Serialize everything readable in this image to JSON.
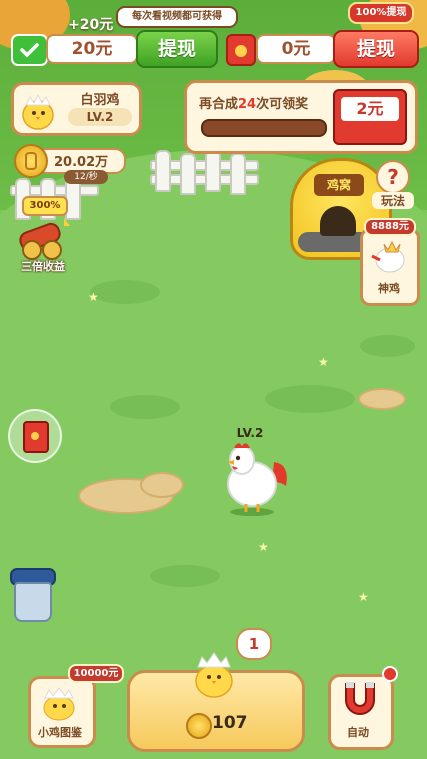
{
  "top": {
    "bonus_text": "+20元",
    "notice": "每次看视频都可获得",
    "badge_100": "100%提现",
    "wechat_amount": "20元",
    "withdraw_left": "提现",
    "redpacket_amount": "0元",
    "withdraw_right": "提现"
  },
  "breed": {
    "name": "白羽鸡",
    "level": "LV.2"
  },
  "reward": {
    "text_pre": "再合成",
    "count": "24",
    "text_post": "次可领奖",
    "amount": "2元",
    "progress": 0.0
  },
  "coins": {
    "total": "20.02万",
    "rate": "12/秒"
  },
  "triple": {
    "badge": "300%",
    "label": "三倍收益"
  },
  "play": {
    "label": "玩法"
  },
  "god_chicken": {
    "badge": "8888元",
    "label": "神鸡"
  },
  "house": {
    "sign": "鸡窝"
  },
  "field_chicken": {
    "level": "LV.2"
  },
  "bottom": {
    "album_badge": "10000元",
    "album_label": "小鸡图鉴",
    "buy_count_bubble": "1",
    "buy_price": "107",
    "auto_label": "自动"
  },
  "colors": {
    "green_button": "#3fa224",
    "red_button": "#e13a2e",
    "card_border": "#c98c4c",
    "grass": "#84ca60"
  }
}
